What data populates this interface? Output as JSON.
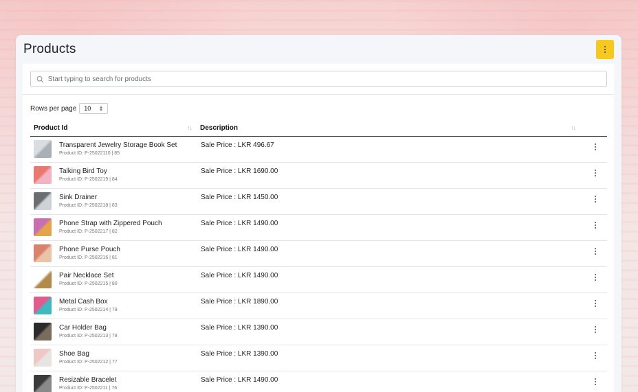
{
  "page": {
    "title": "Products"
  },
  "search": {
    "placeholder": "Start typing to search for products"
  },
  "pagination": {
    "rows_label": "Rows per page",
    "rows_value": "10"
  },
  "table": {
    "headers": {
      "id": "Product Id",
      "description": "Description"
    },
    "rows": [
      {
        "name": "Transparent Jewelry Storage Book Set",
        "sub": "Product ID: P-25022110 | 85",
        "desc": "Sale Price : LKR 496.67",
        "thumb": [
          "#d9dde2",
          "#a9b0b8"
        ]
      },
      {
        "name": "Talking Bird Toy",
        "sub": "Product ID: P-2502219 | 84",
        "desc": "Sale Price : LKR 1690.00",
        "thumb": [
          "#e9786e",
          "#f2b3c3"
        ]
      },
      {
        "name": "Sink Drainer",
        "sub": "Product ID: P-2502218 | 83",
        "desc": "Sale Price : LKR 1450.00",
        "thumb": [
          "#6a6e73",
          "#cfd3d8"
        ]
      },
      {
        "name": "Phone Strap with Zippered Pouch",
        "sub": "Product ID: P-2502217 | 82",
        "desc": "Sale Price : LKR 1490.00",
        "thumb": [
          "#c86fb1",
          "#e3a44a"
        ]
      },
      {
        "name": "Phone Purse Pouch",
        "sub": "Product ID: P-2502216 | 81",
        "desc": "Sale Price : LKR 1490.00",
        "thumb": [
          "#d9836d",
          "#e8c4a8"
        ]
      },
      {
        "name": "Pair Necklace Set",
        "sub": "Product ID: P-2502215 | 80",
        "desc": "Sale Price : LKR 1490.00",
        "thumb": [
          "#ffffff",
          "#b28a4a"
        ]
      },
      {
        "name": "Metal Cash Box",
        "sub": "Product ID: P-2502214 | 79",
        "desc": "Sale Price : LKR 1890.00",
        "thumb": [
          "#e25a8e",
          "#3fb8c0"
        ]
      },
      {
        "name": "Car Holder Bag",
        "sub": "Product ID: P-2502213 | 78",
        "desc": "Sale Price : LKR 1390.00",
        "thumb": [
          "#2b2b2b",
          "#7a6c5a"
        ]
      },
      {
        "name": "Shoe Bag",
        "sub": "Product ID: P-2502212 | 77",
        "desc": "Sale Price : LKR 1390.00",
        "thumb": [
          "#f0c7c7",
          "#e9e4e4"
        ]
      },
      {
        "name": "Resizable Bracelet",
        "sub": "Product ID: P-2502211 | 76",
        "desc": "Sale Price : LKR 1490.00",
        "thumb": [
          "#3a3a3a",
          "#8a8a8a"
        ]
      }
    ]
  },
  "colors": {
    "accent": "#f7c81d",
    "panel_bg": "#f4f6f9"
  }
}
